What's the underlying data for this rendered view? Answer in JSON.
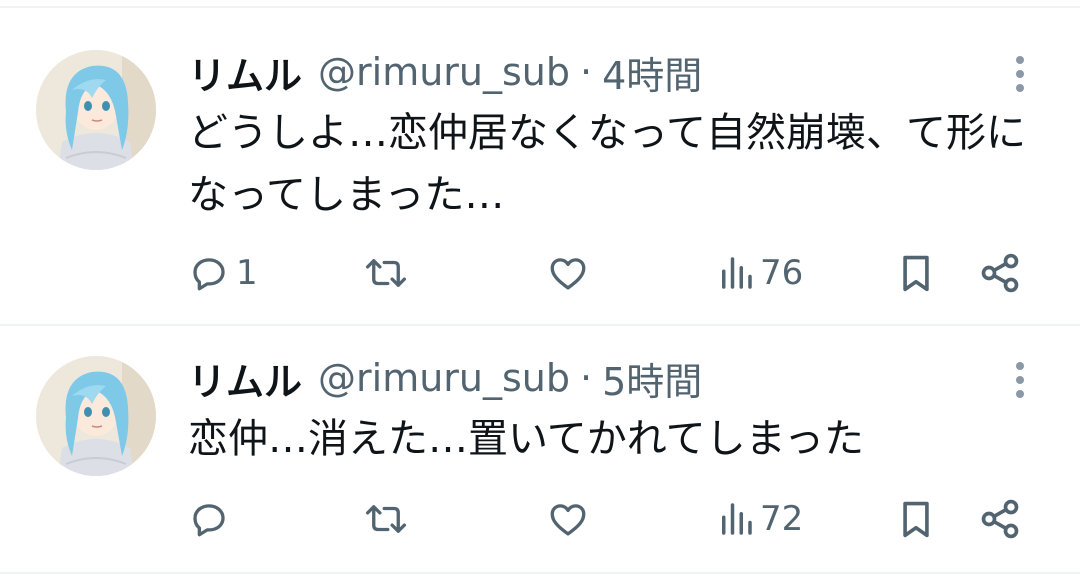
{
  "colors": {
    "text_primary": "#0f1419",
    "text_secondary": "#536471",
    "divider": "#eff3f4"
  },
  "tweets": [
    {
      "name": "リムル",
      "handle": "@rimuru_sub",
      "separator": "·",
      "time": "4時間",
      "text": "どうしよ…恋仲居なくなって自然崩壊、て形になってしまった…",
      "replies": "1",
      "retweets": "",
      "likes": "",
      "views": "76",
      "icons": [
        "reply-icon",
        "retweet-icon",
        "like-icon",
        "views-icon",
        "bookmark-icon",
        "share-icon",
        "more-icon"
      ]
    },
    {
      "name": "リムル",
      "handle": "@rimuru_sub",
      "separator": "·",
      "time": "5時間",
      "text": "恋仲…消えた…置いてかれてしまった",
      "replies": "",
      "retweets": "",
      "likes": "",
      "views": "72",
      "icons": [
        "reply-icon",
        "retweet-icon",
        "like-icon",
        "views-icon",
        "bookmark-icon",
        "share-icon",
        "more-icon"
      ]
    }
  ]
}
